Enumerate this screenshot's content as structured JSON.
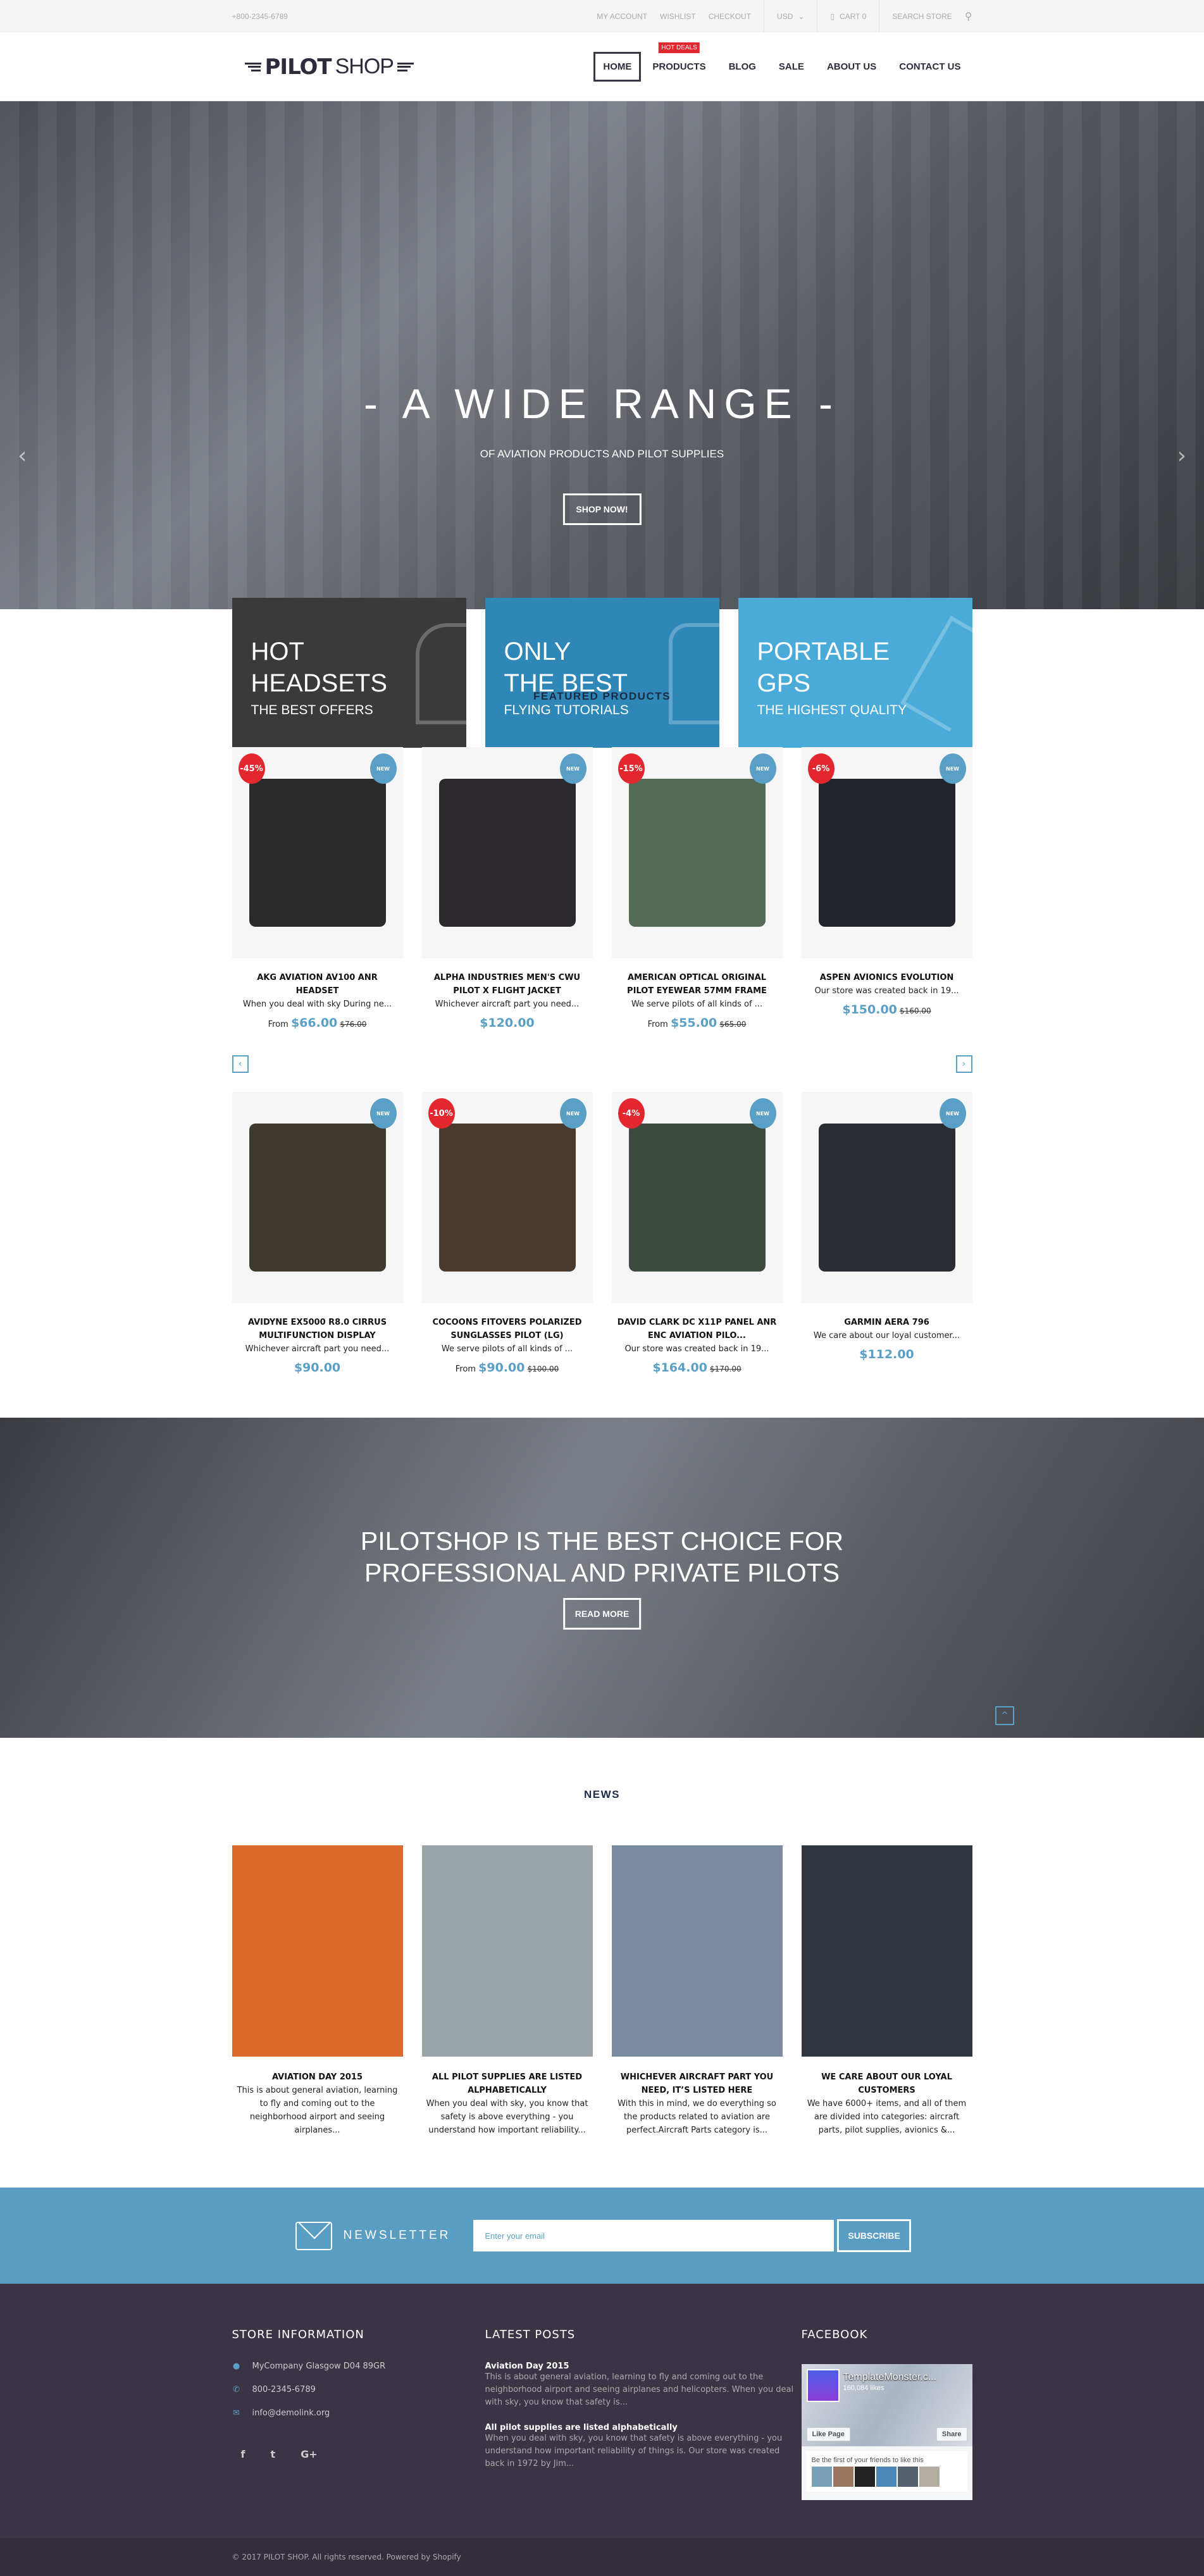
{
  "topbar": {
    "phone": "+800-2345-6789",
    "links": [
      "My Account",
      "Wishlist",
      "Checkout"
    ],
    "currency": "USD",
    "cart": "Cart 0",
    "search": "Search Store"
  },
  "header": {
    "logo_bold": "PILOT",
    "logo_light": "SHOP",
    "nav": [
      {
        "label": "Home",
        "active": true
      },
      {
        "label": "Products",
        "badge": "HOT DEALS"
      },
      {
        "label": "Blog"
      },
      {
        "label": "Sale"
      },
      {
        "label": "About Us"
      },
      {
        "label": "Contact Us"
      }
    ]
  },
  "hero": {
    "title": "- A WIDE RANGE -",
    "subtitle": "OF AVIATION PRODUCTS AND PILOT SUPPLIES",
    "button": "SHOP NOW!"
  },
  "promos": [
    {
      "line1": "HOT",
      "line2": "HEADSETS",
      "sub": "THE BEST OFFERS",
      "color": "#3a3a3a"
    },
    {
      "line1": "ONLY",
      "line2": "THE BEST",
      "sub": "FLYING TUTORIALS",
      "color": "#2f87b8"
    },
    {
      "line1": "PORTABLE",
      "line2": "GPS",
      "sub": "THE HIGHEST QUALITY",
      "color": "#4aabd9"
    }
  ],
  "featured": {
    "title": "FEATURED PRODUCTS",
    "products": [
      {
        "name": "AKG Aviation AV100 ANR Headset",
        "desc": "When you deal with sky During ne...",
        "from": "From",
        "price": "$66.00",
        "old": "$76.00",
        "sale": "-45%",
        "new": "NEW"
      },
      {
        "name": "Alpha Industries Men's CWU Pilot X Flight Jacket",
        "desc": "Whichever aircraft part you need...",
        "from": "",
        "price": "$120.00",
        "old": "",
        "sale": "",
        "new": "NEW"
      },
      {
        "name": "American Optical Original Pilot Eyewear 57mm Frame",
        "desc": "We serve pilots of all kinds of ...",
        "from": "From",
        "price": "$55.00",
        "old": "$65.00",
        "sale": "-15%",
        "new": "NEW"
      },
      {
        "name": "Aspen Avionics Evolution",
        "desc": "Our store was created back in 19...",
        "from": "",
        "price": "$150.00",
        "old": "$160.00",
        "sale": "-6%",
        "new": "NEW"
      },
      {
        "name": "Avidyne EX5000 R8.0 Cirrus Multifunction Display",
        "desc": "Whichever aircraft part you need...",
        "from": "",
        "price": "$90.00",
        "old": "",
        "sale": "",
        "new": "NEW"
      },
      {
        "name": "Cocoons Fitovers Polarized Sunglasses Pilot (LG)",
        "desc": "We serve pilots of all kinds of ...",
        "from": "From",
        "price": "$90.00",
        "old": "$100.00",
        "sale": "-10%",
        "new": "NEW"
      },
      {
        "name": "David Clark DC X11P Panel ANR ENC Aviation Pilo...",
        "desc": "Our store was created back in 19...",
        "from": "",
        "price": "$164.00",
        "old": "$170.00",
        "sale": "-4%",
        "new": "NEW"
      },
      {
        "name": "Garmin Aera 796",
        "desc": "We care about our loyal customer...",
        "from": "",
        "price": "$112.00",
        "old": "",
        "sale": "",
        "new": "NEW"
      }
    ]
  },
  "banner": {
    "line1": "PILOTSHOP IS THE BEST CHOICE FOR",
    "line2": "PROFESSIONAL AND PRIVATE PILOTS",
    "button": "READ MORE"
  },
  "news": {
    "title": "NEWS",
    "items": [
      {
        "title": "Aviation Day 2015",
        "text": "This is about general aviation, learning to fly and coming out to the neighborhood airport and seeing airplanes..."
      },
      {
        "title": "All pilot supplies are listed alphabetically",
        "text": "When you deal with sky, you know that safety is above everything -  you understand how important reliability..."
      },
      {
        "title": "Whichever aircraft part you need, it’s listed here",
        "text": "With this in mind, we do everything so the products related to aviation are perfect.Aircraft Parts category is..."
      },
      {
        "title": "We care about our loyal customers",
        "text": "We have 6000+ items, and all of them are divided into categories: aircraft parts, pilot supplies, avionics &..."
      }
    ]
  },
  "newsletter": {
    "label": "NEWSLETTER",
    "placeholder": "Enter your email",
    "button": "SUBSCRIBE"
  },
  "footer": {
    "store_title": "STORE INFORMATION",
    "address": "MyCompany Glasgow D04 89GR",
    "phone": "800-2345-6789",
    "email": "info@demolink.org",
    "social": [
      "f",
      "t",
      "G+"
    ],
    "posts_title": "LATEST POSTS",
    "posts": [
      {
        "title": "Aviation Day 2015",
        "text": "This is about general aviation, learning to fly and coming out to the neighborhood airport and seeing airplanes and helicopters. When you deal with sky, you know that safety is..."
      },
      {
        "title": "All pilot supplies are listed alphabetically",
        "text": "When you deal with sky, you know that safety is above everything -  you understand how important reliability of things is. Our store was created back in 1972 by Jim..."
      }
    ],
    "facebook_title": "FACEBOOK",
    "fb": {
      "page": "TemplateMonster.c...",
      "likes": "160,084 likes",
      "like_btn": "Like Page",
      "share_btn": "Share",
      "friends": "Be the first of your friends to like this"
    },
    "copyright": "© 2017 PILOT SHOP. All rights reserved. Powered by Shopify"
  }
}
